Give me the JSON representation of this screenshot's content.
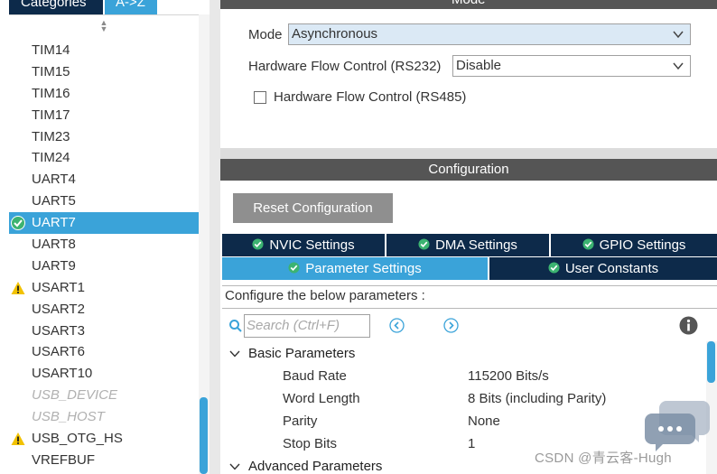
{
  "sidebar": {
    "tab_categories": "Categories",
    "tab_az": "A->Z",
    "items": [
      {
        "label": "TIM14",
        "state": "normal"
      },
      {
        "label": "TIM15",
        "state": "normal"
      },
      {
        "label": "TIM16",
        "state": "normal"
      },
      {
        "label": "TIM17",
        "state": "normal"
      },
      {
        "label": "TIM23",
        "state": "normal"
      },
      {
        "label": "TIM24",
        "state": "normal"
      },
      {
        "label": "UART4",
        "state": "normal"
      },
      {
        "label": "UART5",
        "state": "normal"
      },
      {
        "label": "UART7",
        "state": "selected",
        "icon": "check-circle-icon"
      },
      {
        "label": "UART8",
        "state": "normal"
      },
      {
        "label": "UART9",
        "state": "normal"
      },
      {
        "label": "USART1",
        "state": "normal",
        "icon": "warning-icon"
      },
      {
        "label": "USART2",
        "state": "normal"
      },
      {
        "label": "USART3",
        "state": "normal"
      },
      {
        "label": "USART6",
        "state": "normal"
      },
      {
        "label": "USART10",
        "state": "normal"
      },
      {
        "label": "USB_DEVICE",
        "state": "disabled"
      },
      {
        "label": "USB_HOST",
        "state": "disabled"
      },
      {
        "label": "USB_OTG_HS",
        "state": "normal",
        "icon": "warning-icon"
      },
      {
        "label": "VREFBUF",
        "state": "normal"
      }
    ]
  },
  "mode": {
    "header": "Mode",
    "mode_label": "Mode",
    "mode_value": "Asynchronous",
    "hw_flow_232_label": "Hardware Flow Control (RS232)",
    "hw_flow_232_value": "Disable",
    "hw_flow_485_label": "Hardware Flow Control (RS485)",
    "hw_flow_485_checked": false
  },
  "configuration": {
    "header": "Configuration",
    "reset_label": "Reset Configuration",
    "tabs_row1": [
      "NVIC Settings",
      "DMA Settings",
      "GPIO Settings"
    ],
    "tabs_row2": [
      "Parameter Settings",
      "User Constants"
    ],
    "active_tab": "Parameter Settings",
    "description": "Configure the below parameters :",
    "search_placeholder": "Search (Ctrl+F)",
    "groups": {
      "basic": "Basic Parameters",
      "advanced": "Advanced Parameters"
    },
    "params": [
      {
        "name": "Baud Rate",
        "value": "115200 Bits/s"
      },
      {
        "name": "Word Length",
        "value": "8 Bits (including Parity)"
      },
      {
        "name": "Parity",
        "value": "None"
      },
      {
        "name": "Stop Bits",
        "value": "1"
      }
    ]
  },
  "watermark": "CSDN @青云客-Hugh",
  "colors": {
    "navy": "#0d2a4a",
    "accent": "#3aa3d9",
    "header_gray": "#555555",
    "check_green": "#3cb371",
    "warning_yellow": "#f2c200"
  }
}
